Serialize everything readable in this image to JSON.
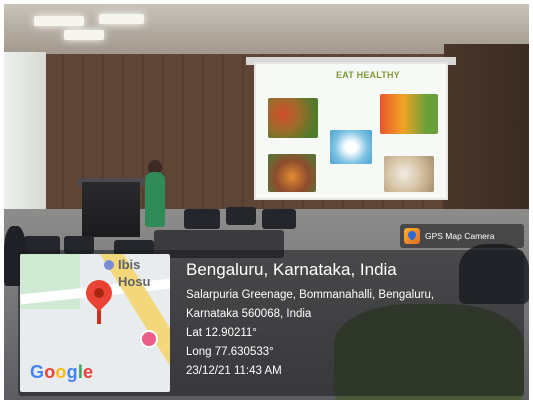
{
  "slide": {
    "title": "EAT HEALTHY"
  },
  "gps_badge": {
    "icon": "gps-map-camera-icon",
    "label": "GPS Map Camera"
  },
  "map": {
    "label": "Ibis\nHosu",
    "logo": "Google"
  },
  "location": {
    "city": "Bengaluru, Karnataka, India",
    "address_line_1": "Salarpuria Greenage, Bommanahalli, Bengaluru,",
    "address_line_2": "Karnataka 560068, India",
    "lat": "Lat 12.90211°",
    "long": "Long 77.630533°",
    "timestamp": "23/12/21 11:43 AM"
  },
  "colors": {
    "pin": "#ea4335",
    "slide_title": "#7d9b39",
    "speaker_outfit": "#2f8b57"
  }
}
